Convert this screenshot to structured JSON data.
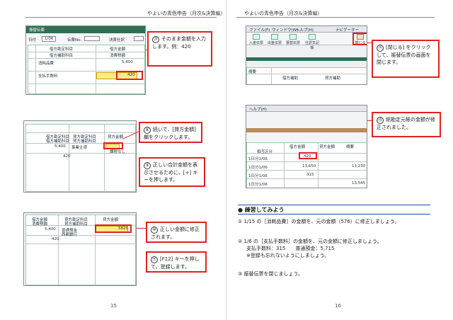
{
  "header_left": "やよいの青色申告（月次&決算編）",
  "header_right": "やよいの青色申告（月次&決算編）",
  "page_left": "15",
  "page_right": "16",
  "shot1": {
    "title": "振替伝票",
    "date_label": "日付",
    "date_value": "1/06",
    "no_label": "伝票No.",
    "settle_label": "決算仕訳",
    "h_debit_acct": "借方勘定科目",
    "h_debit_sub": "借方補助科目",
    "h_credit_acct": "借方金額",
    "h_tax": "消費税額",
    "row1_acct": "消耗品費",
    "row1_amount": "5,400",
    "row2_acct": "支払手数料",
    "row2_amount": "420"
  },
  "shot2": {
    "h1": "借方勘定科目",
    "h2": "借方補助科目",
    "h3": "貸方金額",
    "h4": "貸方勘定科目",
    "h5": "貸方補助科目",
    "v1": "5,400",
    "v2": "420",
    "c1": "事業主貸",
    "c2": "普通預金",
    "note": "課税なし"
  },
  "shot3": {
    "h1": "借方金額",
    "h2": "貸方勘定科目",
    "h3": "貸方金額",
    "h4": "消費税額",
    "h5": "貸方補助科目",
    "v1": "5,400",
    "v2": "420",
    "c1": "普通預金",
    "c2": "西都銀行",
    "total": "5820"
  },
  "shot4": {
    "menu": [
      "ファイル(F)",
      "ウィンドウ(W)",
      "ヘルプ(H)",
      "ナビゲーター"
    ],
    "tools": [
      "閉じる",
      "入金伝票",
      "出金伝票",
      "振替伝票",
      "仕訳日記帳"
    ],
    "close_label": "閉じる",
    "h1": "摘要",
    "h2": "借方補助",
    "h3": "貸方補助"
  },
  "shot5": {
    "menu": "ヘルプ(H)",
    "h1": "借方金額",
    "h2": "貸方金額",
    "h3": "摘要",
    "r_label": "相互区分",
    "v_top": "420",
    "v_row2": "13,650",
    "v_row3": "13,230",
    "v_row4": "315",
    "v_row5": "13,545",
    "rows": [
      "1日分1/06",
      "1日分1/06",
      "1日分1/06",
      "1日分1/06"
    ]
  },
  "callouts": {
    "c7_num": "⑦",
    "c7": "そのまま金額を入力します。例：420",
    "c8_num": "⑧",
    "c8": "続いて、[貸方金額] 欄をクリックします。",
    "c9_num": "⑨",
    "c9": "正しい合計金額を表示させるために、[+] キーを押します。",
    "c10_num": "⑩",
    "c10": "正しい金額に修正されます。",
    "c11_num": "⑪",
    "c11": "[F12] キーを押して、登録します。",
    "c12_num": "⑫",
    "c12": "[閉じる] をクリックして、振替伝票の画面を閉じます。",
    "c13_num": "⑬",
    "c13": "総勘定元帳の金額が修正されました。"
  },
  "exercise": {
    "title": "練習してみよう",
    "q1": "① 1/15 の［消耗品費］の金額を、元の金額（576）に修正しましょう。",
    "q2a": "② 1/6 の［支払手数料］の金額を、元の金額に修正しましょう。",
    "q2b": "支払手数料：315　　普通預金：5,715",
    "q2c": "※登録も忘れないようにしましょう。",
    "q3": "③ 振替伝票を閉じましょう。"
  }
}
